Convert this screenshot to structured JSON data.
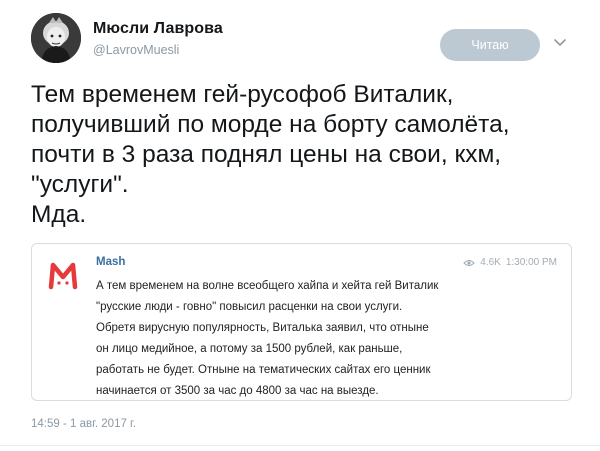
{
  "author": {
    "name": "Мюсли Лаврова",
    "handle": "@LavrovMuesli"
  },
  "follow_button": {
    "label": "Читаю",
    "color": "#bcc9d3"
  },
  "menu_icon": "chevron-down-icon",
  "tweet": {
    "text": "Тем временем гей-русофоб Виталик,\nполучивший по морде на борту самолёта,\nпочти в 3 раза поднял цены на свои, кхм,\n\"услуги\".\nМда.",
    "timestamp": "14:59 - 1 авг. 2017 г."
  },
  "quoted_post": {
    "source_name": "Mash",
    "logo_color": "#e5393b",
    "views": "4.6K",
    "time": "1:30:00 PM",
    "text": "А тем временем на волне всеобщего хайпа и хейта гей Виталик\n\"русские люди - говно\" повысил расценки на свои услуги.\nОбретя вирусную популярность, Виталька заявил, что отныне\nон лицо медийное, а потому за 1500 рублей, как раньше,\nработать не будет. Отныне на тематических сайтах его ценник\nначинается от 3500 за час до 4800 за час на выезде."
  }
}
